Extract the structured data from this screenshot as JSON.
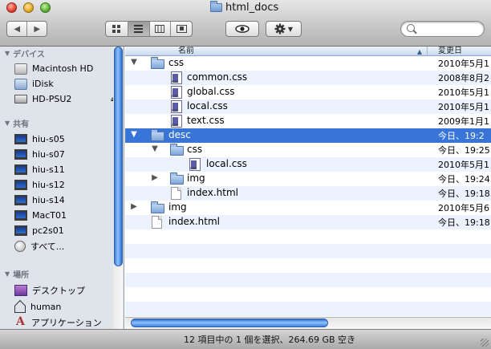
{
  "window": {
    "title": "html_docs"
  },
  "toolbar": {
    "back_glyph": "◀",
    "forward_glyph": "▶",
    "search": {
      "value": "",
      "placeholder": ""
    }
  },
  "sidebar": {
    "devices_heading": "デバイス",
    "devices": [
      {
        "label": "Macintosh HD",
        "icon": "hard-drive-icon"
      },
      {
        "label": "iDisk",
        "icon": "idisk-icon"
      },
      {
        "label": "HD-PSU2",
        "icon": "external-drive-icon",
        "eject": "⏏"
      }
    ],
    "shared_heading": "共有",
    "shared": [
      {
        "label": "hiu-s05",
        "icon": "computer-icon"
      },
      {
        "label": "hiu-s07",
        "icon": "computer-icon"
      },
      {
        "label": "hiu-s11",
        "icon": "computer-icon"
      },
      {
        "label": "hiu-s12",
        "icon": "computer-icon"
      },
      {
        "label": "hiu-s14",
        "icon": "computer-icon"
      },
      {
        "label": "MacT01",
        "icon": "computer-icon"
      },
      {
        "label": "pc2s01",
        "icon": "computer-icon"
      },
      {
        "label": "すべて...",
        "icon": "network-globe-icon"
      }
    ],
    "places_heading": "場所",
    "places": [
      {
        "label": "デスクトップ",
        "icon": "desktop-icon"
      },
      {
        "label": "human",
        "icon": "home-icon"
      },
      {
        "label": "アプリケーション",
        "icon": "applications-icon"
      }
    ]
  },
  "columns": {
    "name": "名前",
    "date": "変更日"
  },
  "files": [
    {
      "name": "css",
      "date": "2010年5月1",
      "kind": "folder",
      "disclosure": "▼"
    },
    {
      "name": "common.css",
      "date": "2008年8月2",
      "kind": "css"
    },
    {
      "name": "global.css",
      "date": "2010年5月1",
      "kind": "css"
    },
    {
      "name": "local.css",
      "date": "2010年5月1",
      "kind": "css"
    },
    {
      "name": "text.css",
      "date": "2009年1月1",
      "kind": "css"
    },
    {
      "name": "desc",
      "date": "今日、19:2",
      "kind": "folder",
      "disclosure": "▼",
      "selected": true
    },
    {
      "name": "css",
      "date": "今日、19:25",
      "kind": "folder",
      "disclosure": "▼"
    },
    {
      "name": "local.css",
      "date": "2010年5月1",
      "kind": "css"
    },
    {
      "name": "img",
      "date": "今日、19:24",
      "kind": "folder",
      "disclosure": "▶"
    },
    {
      "name": "index.html",
      "date": "今日、19:18",
      "kind": "html"
    },
    {
      "name": "img",
      "date": "2010年5月6",
      "kind": "folder",
      "disclosure": "▶"
    },
    {
      "name": "index.html",
      "date": "今日、19:18",
      "kind": "html"
    }
  ],
  "status": {
    "text": "12 項目中の 1 個を選択、264.69 GB 空き"
  }
}
